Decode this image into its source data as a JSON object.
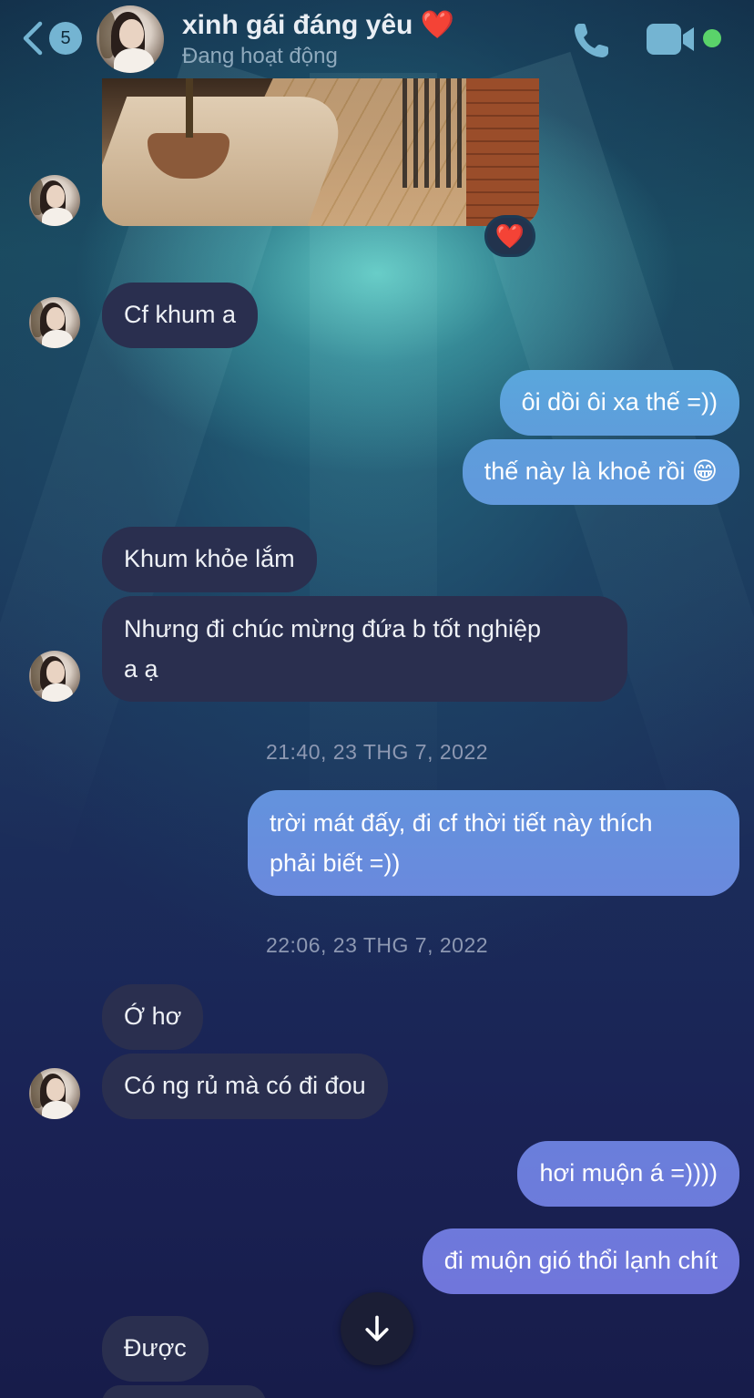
{
  "header": {
    "back_count": "5",
    "contact_name": "xinh gái đáng yêu",
    "contact_name_emoji": "❤️",
    "status": "Đang hoạt động",
    "online_color": "#5ad36a",
    "icons": [
      "back-chevron-icon",
      "phone-icon",
      "video-camera-icon"
    ]
  },
  "conversation": {
    "image_reaction": "❤️",
    "messages": [
      {
        "side": "in",
        "text": "Cf khum a"
      },
      {
        "side": "out",
        "text": "ôi dồi ôi xa thế =))"
      },
      {
        "side": "out",
        "text": "thế này là khoẻ rồi 😁"
      },
      {
        "side": "in",
        "text": "Khum khỏe lắm"
      },
      {
        "side": "in",
        "line1": "Nhưng đi chúc mừng đứa b tốt nghiệp",
        "line2": "a ạ"
      },
      {
        "side": "out",
        "line1": "trời mát đấy, đi cf thời tiết này thích",
        "line2": "phải biết =))"
      },
      {
        "side": "in",
        "text": "Ớ hơ"
      },
      {
        "side": "in",
        "text": "Có ng rủ mà có đi đou"
      },
      {
        "side": "out",
        "text": "hơi muộn á =))))"
      },
      {
        "side": "out",
        "text": "đi muộn gió thổi lạnh chít"
      },
      {
        "side": "in",
        "text": "Được"
      }
    ],
    "timestamps": [
      "21:40, 23 THG 7, 2022",
      "22:06, 23 THG 7, 2022"
    ]
  },
  "colors": {
    "incoming_bubble": "#2a2f4f",
    "outgoing_bubble_top": "#5b9bd5",
    "outgoing_bubble_bottom": "#6a78d8"
  }
}
